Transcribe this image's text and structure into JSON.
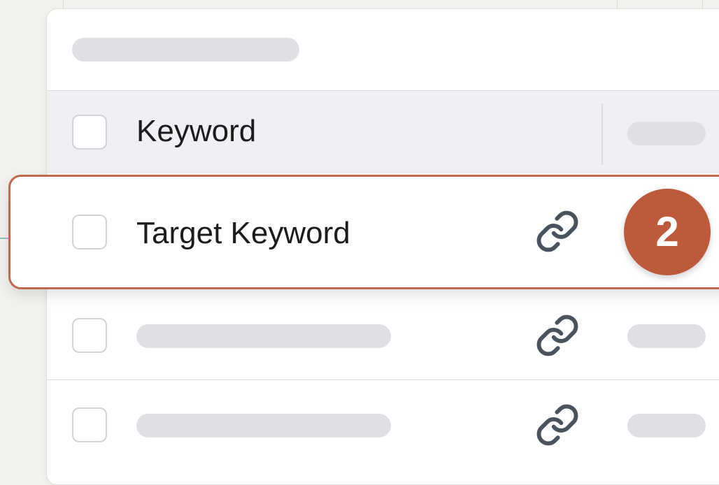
{
  "table": {
    "header": {
      "keyword_column_label": "Keyword"
    },
    "highlighted_row": {
      "keyword": "Target Keyword",
      "link_icon": "link-icon"
    },
    "placeholder_rows": [
      {
        "link_icon": "link-icon"
      },
      {
        "link_icon": "link-icon"
      }
    ]
  },
  "annotation": {
    "step_number": "2",
    "badge_color": "#bd5a3b",
    "highlight_border_color": "#c0684e"
  }
}
